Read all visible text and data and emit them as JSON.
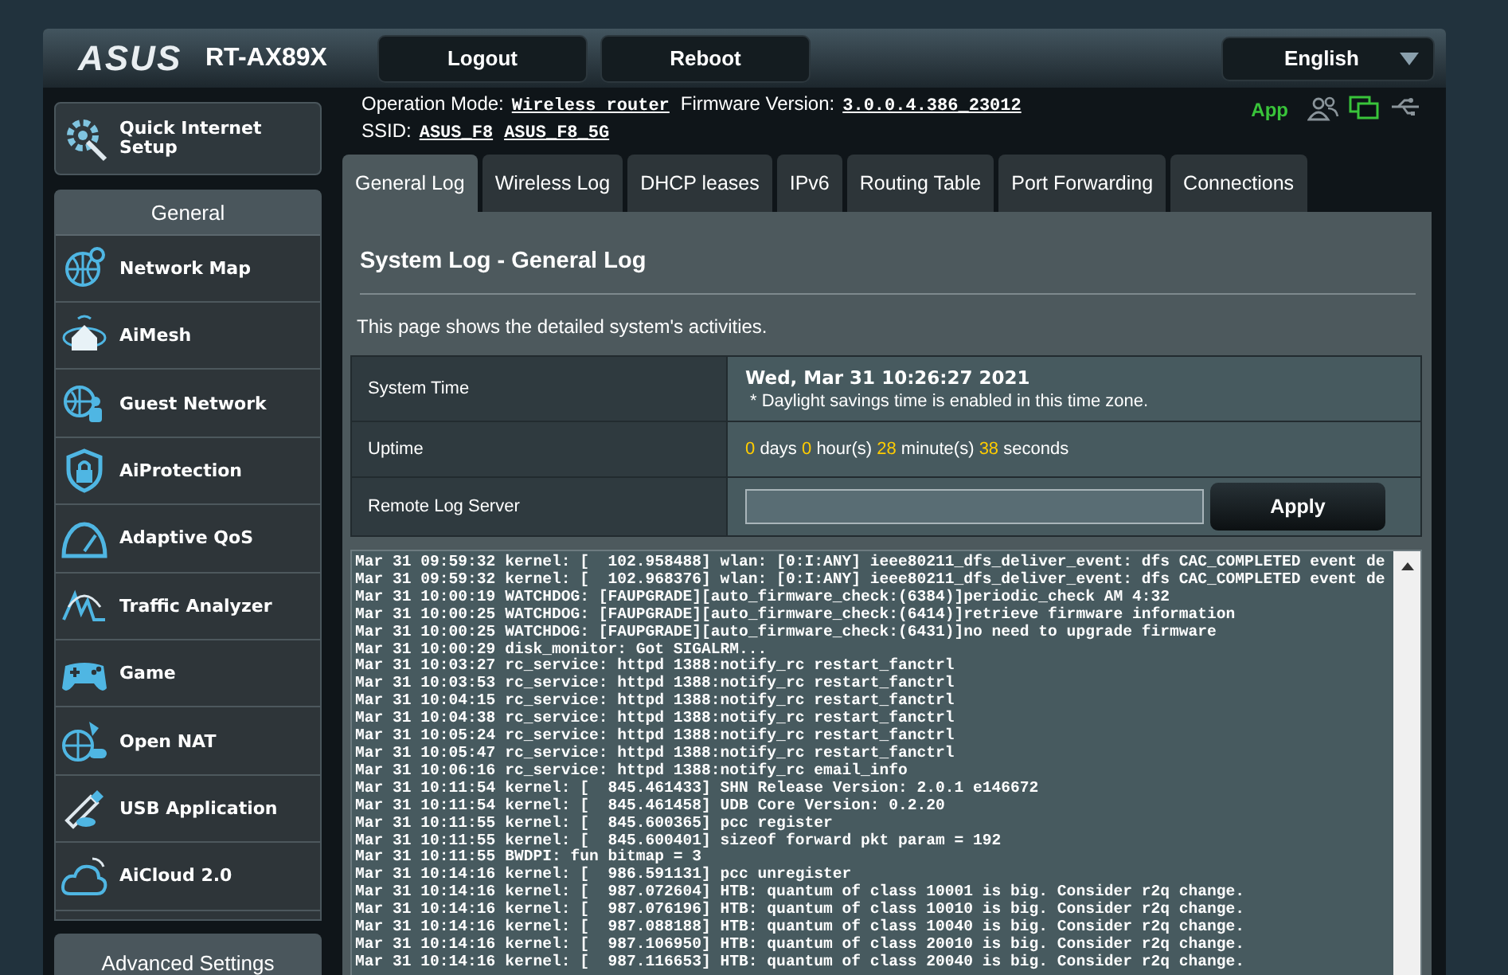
{
  "header": {
    "brand": "ASUS",
    "model": "RT-AX89X",
    "buttons": [
      "Logout",
      "Reboot"
    ],
    "language": "English"
  },
  "info": {
    "operation_mode_label": "Operation Mode:",
    "operation_mode": "Wireless router",
    "firmware_label": "Firmware Version:",
    "firmware": "3.0.0.4.386_23012",
    "ssid_label": "SSID:",
    "ssids": [
      "ASUS_F8",
      "ASUS_F8_5G"
    ],
    "app": "App"
  },
  "quick_setup": "Quick Internet Setup",
  "sidebar": {
    "title": "General",
    "items": [
      {
        "label": "Network Map",
        "selected": false
      },
      {
        "label": "AiMesh",
        "selected": false
      },
      {
        "label": "Guest Network",
        "selected": false
      },
      {
        "label": "AiProtection",
        "selected": false
      },
      {
        "label": "Adaptive QoS",
        "selected": false
      },
      {
        "label": "Traffic Analyzer",
        "selected": false
      },
      {
        "label": "Game",
        "selected": false
      },
      {
        "label": "Open NAT",
        "selected": false
      },
      {
        "label": "USB Application",
        "selected": false
      },
      {
        "label": "AiCloud 2.0",
        "selected": false
      }
    ],
    "advanced_title": "Advanced Settings"
  },
  "tabs": [
    {
      "label": "General Log",
      "selected": true
    },
    {
      "label": "Wireless Log",
      "selected": false
    },
    {
      "label": "DHCP leases",
      "selected": false
    },
    {
      "label": "IPv6",
      "selected": false
    },
    {
      "label": "Routing Table",
      "selected": false
    },
    {
      "label": "Port Forwarding",
      "selected": false
    },
    {
      "label": "Connections",
      "selected": false
    }
  ],
  "page": {
    "title": "System Log - General Log",
    "description": "This page shows the detailed system's activities.",
    "system_time_label": "System Time",
    "system_time": "Wed, Mar 31 10:26:27 2021",
    "dst_note": "* Daylight savings time is enabled in this time zone.",
    "uptime_label": "Uptime",
    "uptime": [
      {
        "text": "0",
        "kind": "value"
      },
      {
        "text": "days",
        "kind": "unit"
      },
      {
        "text": "0",
        "kind": "value"
      },
      {
        "text": "hour(s)",
        "kind": "unit"
      },
      {
        "text": "28",
        "kind": "value"
      },
      {
        "text": "minute(s)",
        "kind": "unit"
      },
      {
        "text": "38",
        "kind": "value"
      },
      {
        "text": "seconds",
        "kind": "unit"
      }
    ],
    "remote_label": "Remote Log Server",
    "apply": "Apply"
  },
  "log": [
    "Mar 31 09:59:32 kernel: [  102.958488] wlan: [0:I:ANY] ieee80211_dfs_deliver_event: dfs CAC_COMPLETED event de",
    "Mar 31 09:59:32 kernel: [  102.968376] wlan: [0:I:ANY] ieee80211_dfs_deliver_event: dfs CAC_COMPLETED event de",
    "Mar 31 10:00:19 WATCHDOG: [FAUPGRADE][auto_firmware_check:(6384)]periodic_check AM 4:32",
    "Mar 31 10:00:25 WATCHDOG: [FAUPGRADE][auto_firmware_check:(6414)]retrieve firmware information",
    "Mar 31 10:00:25 WATCHDOG: [FAUPGRADE][auto_firmware_check:(6431)]no need to upgrade firmware",
    "Mar 31 10:00:29 disk_monitor: Got SIGALRM...",
    "Mar 31 10:03:27 rc_service: httpd 1388:notify_rc restart_fanctrl",
    "Mar 31 10:03:53 rc_service: httpd 1388:notify_rc restart_fanctrl",
    "Mar 31 10:04:15 rc_service: httpd 1388:notify_rc restart_fanctrl",
    "Mar 31 10:04:38 rc_service: httpd 1388:notify_rc restart_fanctrl",
    "Mar 31 10:05:24 rc_service: httpd 1388:notify_rc restart_fanctrl",
    "Mar 31 10:05:47 rc_service: httpd 1388:notify_rc restart_fanctrl",
    "Mar 31 10:06:16 rc_service: httpd 1388:notify_rc email_info",
    "Mar 31 10:11:54 kernel: [  845.461433] SHN Release Version: 2.0.1 e146672",
    "Mar 31 10:11:54 kernel: [  845.461458] UDB Core Version: 0.2.20",
    "Mar 31 10:11:55 kernel: [  845.600365] pcc register",
    "Mar 31 10:11:55 kernel: [  845.600401] sizeof forward pkt param = 192",
    "Mar 31 10:11:55 BWDPI: fun bitmap = 3",
    "Mar 31 10:14:16 kernel: [  986.591131] pcc unregister",
    "Mar 31 10:14:16 kernel: [  987.072604] HTB: quantum of class 10001 is big. Consider r2q change.",
    "Mar 31 10:14:16 kernel: [  987.076196] HTB: quantum of class 10010 is big. Consider r2q change.",
    "Mar 31 10:14:16 kernel: [  987.088188] HTB: quantum of class 10040 is big. Consider r2q change.",
    "Mar 31 10:14:16 kernel: [  987.106950] HTB: quantum of class 20010 is big. Consider r2q change.",
    "Mar 31 10:14:16 kernel: [  987.116653] HTB: quantum of class 20040 is big. Consider r2q change."
  ]
}
